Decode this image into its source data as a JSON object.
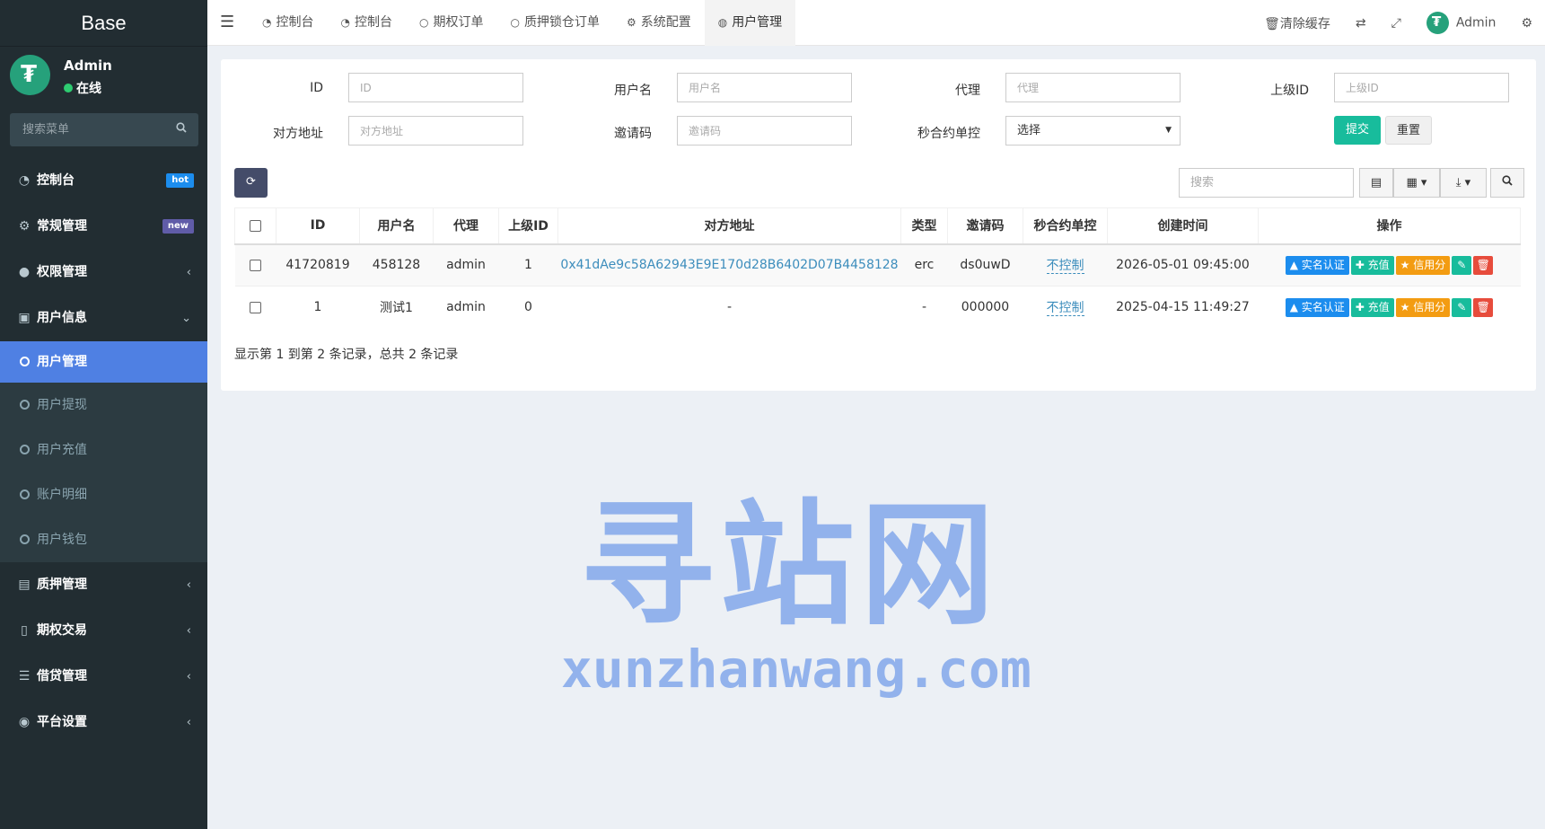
{
  "sidebar": {
    "brand": "Base",
    "user": {
      "name": "Admin",
      "status": "在线"
    },
    "search_placeholder": "搜索菜单",
    "items": [
      {
        "label": "控制台",
        "icon": "dashboard-icon",
        "badge": "hot"
      },
      {
        "label": "常规管理",
        "icon": "cogs-icon",
        "badge": "new"
      },
      {
        "label": "权限管理",
        "icon": "group-icon"
      },
      {
        "label": "用户信息",
        "icon": "user-card-icon"
      }
    ],
    "subitems": [
      {
        "label": "用户管理",
        "active": true
      },
      {
        "label": "用户提现"
      },
      {
        "label": "用户充值"
      },
      {
        "label": "账户明细"
      },
      {
        "label": "用户钱包"
      }
    ],
    "bottom_items": [
      {
        "label": "质押管理",
        "icon": "pledge-icon"
      },
      {
        "label": "期权交易",
        "icon": "file-icon"
      },
      {
        "label": "借贷管理",
        "icon": "list-icon"
      },
      {
        "label": "平台设置",
        "icon": "circle-dot-icon"
      }
    ]
  },
  "topnav": {
    "tabs": [
      {
        "label": "控制台",
        "icon": "dashboard-icon"
      },
      {
        "label": "控制台",
        "icon": "dashboard-icon"
      },
      {
        "label": "期权订单",
        "icon": "circle-icon"
      },
      {
        "label": "质押锁仓订单",
        "icon": "circle-icon"
      },
      {
        "label": "系统配置",
        "icon": "gear-icon"
      },
      {
        "label": "用户管理",
        "icon": "user-circle-icon",
        "active": true
      }
    ],
    "clear_cache": "清除缓存",
    "admin_name": "Admin"
  },
  "filters": {
    "id": {
      "label": "ID",
      "placeholder": "ID"
    },
    "username": {
      "label": "用户名",
      "placeholder": "用户名"
    },
    "agent": {
      "label": "代理",
      "placeholder": "代理"
    },
    "parent_id": {
      "label": "上级ID",
      "placeholder": "上级ID"
    },
    "address": {
      "label": "对方地址",
      "placeholder": "对方地址"
    },
    "invite": {
      "label": "邀请码",
      "placeholder": "邀请码"
    },
    "control": {
      "label": "秒合约单控",
      "value": "选择"
    },
    "submit": "提交",
    "reset": "重置"
  },
  "toolbar": {
    "search_placeholder": "搜索"
  },
  "table": {
    "columns": [
      "ID",
      "用户名",
      "代理",
      "上级ID",
      "对方地址",
      "类型",
      "邀请码",
      "秒合约单控",
      "创建时间",
      "操作"
    ],
    "rows": [
      {
        "id": "41720819",
        "username": "458128",
        "agent": "admin",
        "parent_id": "1",
        "address": "0x41dAe9c58A62943E9E170d28B6402D07B4458128",
        "type": "erc",
        "invite": "ds0uwD",
        "control": "不控制",
        "created": "2026-05-01 09:45:00"
      },
      {
        "id": "1",
        "username": "测试1",
        "agent": "admin",
        "parent_id": "0",
        "address": "-",
        "type": "-",
        "invite": "000000",
        "control": "不控制",
        "created": "2025-04-15 11:49:27"
      }
    ],
    "actions": {
      "real": "实名认证",
      "recharge": "充值",
      "credit": "信用分"
    },
    "summary": "显示第 1 到第 2 条记录，总共 2 条记录"
  },
  "watermark": {
    "big": "寻站网",
    "small": "xunzhanwang.com"
  }
}
